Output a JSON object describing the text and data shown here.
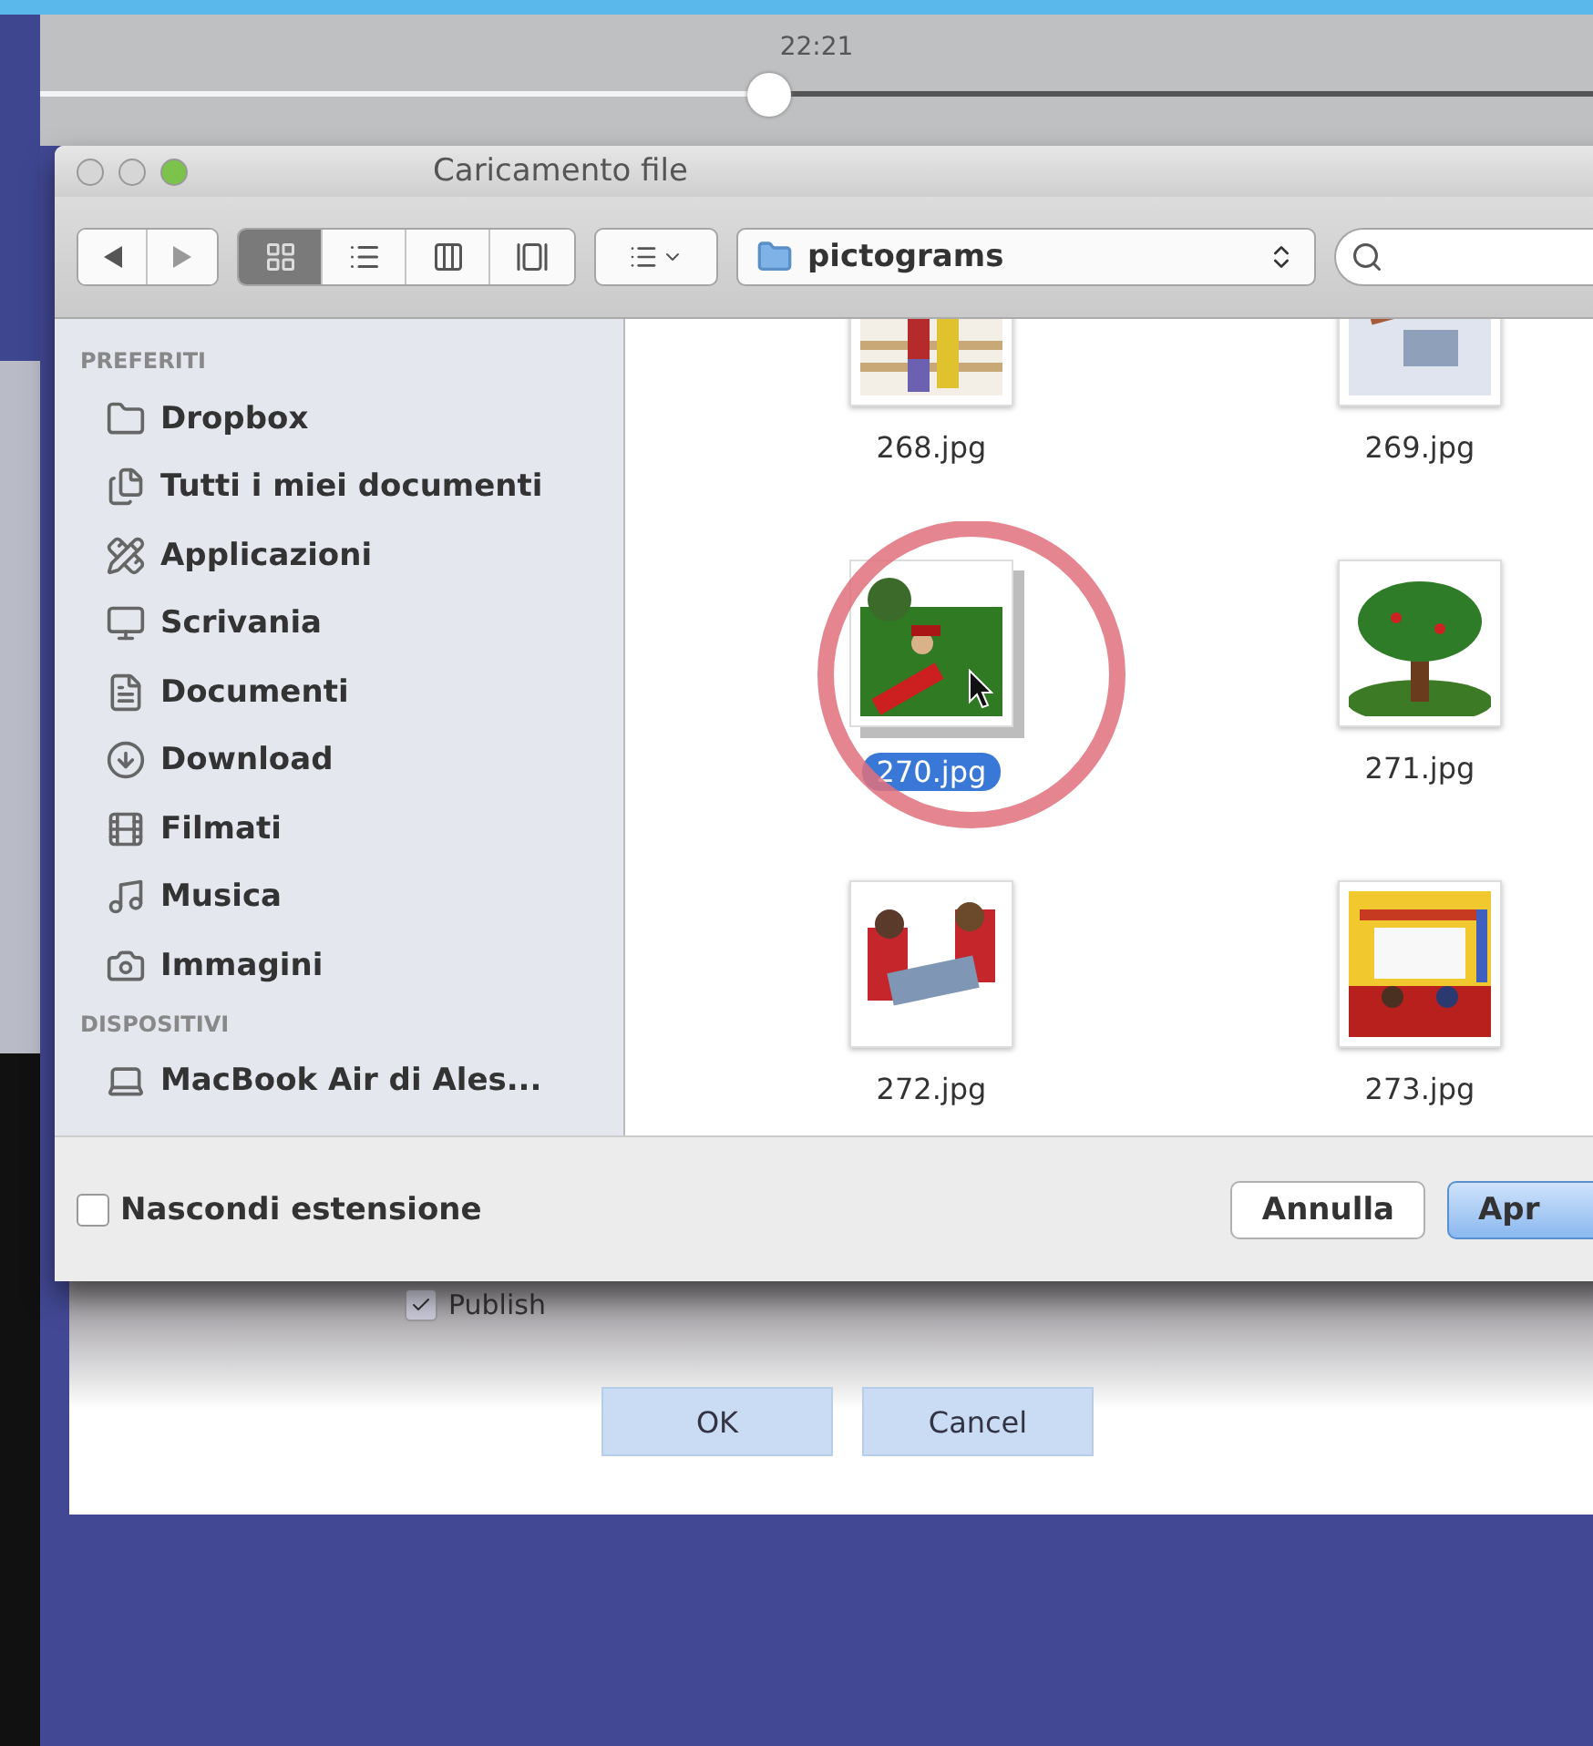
{
  "player": {
    "time": "22:21",
    "level": 0.47
  },
  "dialog": {
    "title": "Caricamento file",
    "toolbar": {
      "view_modes": [
        {
          "selected": true
        },
        {
          "selected": false
        },
        {
          "selected": false
        },
        {
          "selected": false
        }
      ],
      "path": "pictograms"
    },
    "sidebar": [
      {
        "heading": "PREFERITI",
        "items": [
          {
            "label": "Dropbox"
          },
          {
            "label": "Tutti i miei documenti"
          },
          {
            "label": "Applicazioni"
          },
          {
            "label": "Scrivania"
          },
          {
            "label": "Documenti"
          },
          {
            "label": "Download"
          },
          {
            "label": "Filmati"
          },
          {
            "label": "Musica"
          },
          {
            "label": "Immagini"
          }
        ]
      },
      {
        "heading": "DISPOSITIVI",
        "items": [
          {
            "label": "MacBook Air di Ales..."
          }
        ]
      }
    ],
    "files": [
      {
        "name": "268.jpg",
        "selected": false
      },
      {
        "name": "269.jpg",
        "selected": false
      },
      {
        "name": "270.jpg",
        "selected": true
      },
      {
        "name": "271.jpg",
        "selected": false
      },
      {
        "name": "272.jpg",
        "selected": false
      },
      {
        "name": "273.jpg",
        "selected": false
      }
    ],
    "footer": {
      "hide_extension": {
        "label": "Nascondi estensione",
        "checked": false
      },
      "buttons": [
        {
          "label": "Annulla",
          "kind": "secondary"
        },
        {
          "label": "Apr",
          "kind": "default"
        }
      ]
    }
  },
  "form": {
    "publish": {
      "label": "Publish",
      "checked": true
    },
    "buttons": [
      {
        "label": "OK"
      },
      {
        "label": "Cancel"
      }
    ]
  }
}
